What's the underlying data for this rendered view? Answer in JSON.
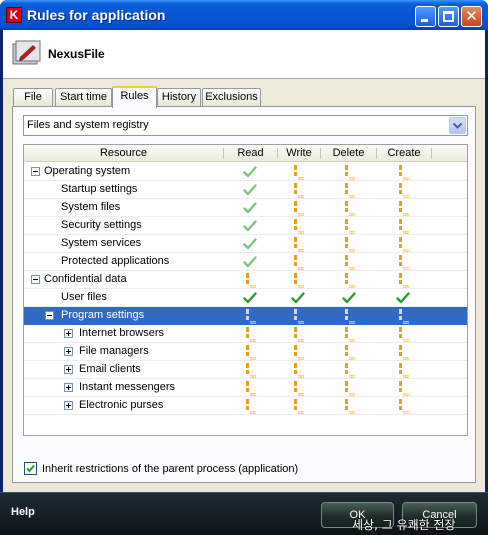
{
  "window": {
    "title": "Rules for application",
    "logo_letter": "K"
  },
  "app": {
    "name": "NexusFile"
  },
  "tabs": [
    {
      "label": "File"
    },
    {
      "label": "Start time"
    },
    {
      "label": "Rules",
      "active": true
    },
    {
      "label": "History"
    },
    {
      "label": "Exclusions"
    }
  ],
  "category_select": {
    "value": "Files and system registry"
  },
  "table": {
    "columns": [
      "Resource",
      "Read",
      "Write",
      "Delete",
      "Create"
    ],
    "rows": [
      {
        "label": "Operating system",
        "level": 0,
        "expander": "minus",
        "perms": [
          "allow-inherited",
          "ask",
          "ask",
          "ask"
        ]
      },
      {
        "label": "Startup settings",
        "level": 1,
        "expander": "none",
        "perms": [
          "allow-inherited",
          "ask",
          "ask",
          "ask"
        ]
      },
      {
        "label": "System files",
        "level": 1,
        "expander": "none",
        "perms": [
          "allow-inherited",
          "ask",
          "ask",
          "ask"
        ]
      },
      {
        "label": "Security settings",
        "level": 1,
        "expander": "none",
        "perms": [
          "allow-inherited",
          "ask",
          "ask",
          "ask"
        ]
      },
      {
        "label": "System services",
        "level": 1,
        "expander": "none",
        "perms": [
          "allow-inherited",
          "ask",
          "ask",
          "ask"
        ]
      },
      {
        "label": "Protected applications",
        "level": 1,
        "expander": "none",
        "perms": [
          "allow-inherited",
          "ask",
          "ask",
          "ask"
        ]
      },
      {
        "label": "Confidential data",
        "level": 0,
        "expander": "minus",
        "perms": [
          "ask",
          "ask",
          "ask",
          "ask"
        ]
      },
      {
        "label": "User files",
        "level": 1,
        "expander": "none",
        "perms": [
          "allow",
          "allow",
          "allow",
          "allow"
        ]
      },
      {
        "label": "Program settings",
        "level": 1,
        "expander": "minus",
        "selected": true,
        "perms": [
          "ask-selected",
          "ask-selected",
          "ask-selected",
          "ask-selected"
        ]
      },
      {
        "label": "Internet browsers",
        "level": 2,
        "expander": "plus",
        "perms": [
          "ask",
          "ask",
          "ask",
          "ask"
        ]
      },
      {
        "label": "File managers",
        "level": 2,
        "expander": "plus",
        "perms": [
          "ask",
          "ask",
          "ask",
          "ask"
        ]
      },
      {
        "label": "Email clients",
        "level": 2,
        "expander": "plus",
        "perms": [
          "ask",
          "ask",
          "ask",
          "ask"
        ]
      },
      {
        "label": "Instant messengers",
        "level": 2,
        "expander": "plus",
        "perms": [
          "ask",
          "ask",
          "ask",
          "ask"
        ]
      },
      {
        "label": "Electronic purses",
        "level": 2,
        "expander": "plus",
        "perms": [
          "ask",
          "ask",
          "ask",
          "ask"
        ]
      }
    ]
  },
  "inherit": {
    "label": "Inherit restrictions of the parent process (application)",
    "checked": true
  },
  "footer": {
    "help": "Help",
    "ok": "OK",
    "cancel": "Cancel"
  },
  "watermark": "세상, 그 유쾌한 전장",
  "colors": {
    "allow": "#2e9a2e",
    "allow_inherited": "#7cc47c",
    "ask": "#e6a020",
    "selected_row": "#316ac5"
  }
}
